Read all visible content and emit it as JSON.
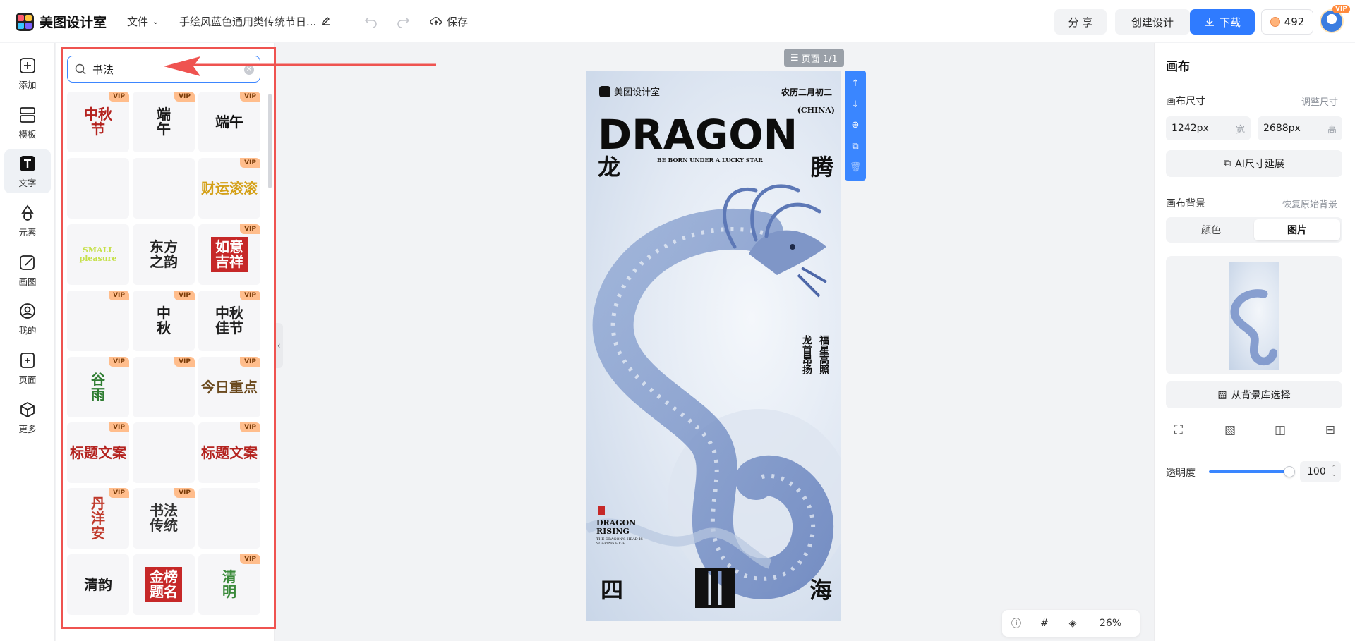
{
  "topbar": {
    "brand": "美图设计室",
    "file_menu": "文件",
    "doc_title": "手绘风蓝色通用类传统节日...",
    "save": "保存",
    "share": "分 享",
    "create": "创建设计",
    "download": "下载",
    "points": "492",
    "vip_badge": "VIP"
  },
  "rail": {
    "items": [
      {
        "label": "添加",
        "icon": "plus-square-icon"
      },
      {
        "label": "模板",
        "icon": "template-icon"
      },
      {
        "label": "文字",
        "icon": "text-icon"
      },
      {
        "label": "元素",
        "icon": "shapes-icon"
      },
      {
        "label": "画图",
        "icon": "draw-icon"
      },
      {
        "label": "我的",
        "icon": "user-icon"
      },
      {
        "label": "页面",
        "icon": "page-add-icon"
      },
      {
        "label": "更多",
        "icon": "box-icon"
      }
    ]
  },
  "panel": {
    "search_value": "书法",
    "vip": "VIP",
    "cells": [
      {
        "text": "中秋\n节",
        "color": "#b4231f",
        "vip": true
      },
      {
        "text": "端\n午",
        "color": "#1b1b1b",
        "vip": true
      },
      {
        "text": "端午",
        "color": "#111111",
        "vip": true
      },
      {
        "text": "",
        "color": "#555555",
        "vip": false
      },
      {
        "text": "",
        "color": "#c62828",
        "vip": false
      },
      {
        "text": "财运滚滚",
        "color": "#d4a017",
        "vip": true
      },
      {
        "text": "SMALL\npleasure",
        "color": "#c6e04a",
        "vip": false
      },
      {
        "text": "东方\n之韵",
        "color": "#222222",
        "vip": false
      },
      {
        "text": "如意\n吉祥",
        "color": "#ffffff",
        "vip": true
      },
      {
        "text": "",
        "color": "#f5e7b8",
        "vip": true
      },
      {
        "text": "中\n秋",
        "color": "#1a1a1a",
        "vip": true
      },
      {
        "text": "中秋\n佳节",
        "color": "#222222",
        "vip": true
      },
      {
        "text": "谷\n雨",
        "color": "#2f7d32",
        "vip": true
      },
      {
        "text": "",
        "color": "#e8c9a0",
        "vip": true
      },
      {
        "text": "今日重点",
        "color": "#6b4a1e",
        "vip": true
      },
      {
        "text": "标题文案",
        "color": "#b4231f",
        "vip": true
      },
      {
        "text": "",
        "color": "#f0f0f0",
        "vip": false
      },
      {
        "text": "标题文案",
        "color": "#b4231f",
        "vip": true
      },
      {
        "text": "丹\n洋\n安",
        "color": "#c0392b",
        "vip": true
      },
      {
        "text": "书法\n传统",
        "color": "#333333",
        "vip": true
      },
      {
        "text": "",
        "color": "#c62828",
        "vip": false
      },
      {
        "text": "清韵",
        "color": "#1a1a1a",
        "vip": false
      },
      {
        "text": "金榜\n题名",
        "color": "#ffffff",
        "vip": false
      },
      {
        "text": "清\n明",
        "color": "#3a8a3a",
        "vip": true
      }
    ]
  },
  "canvas": {
    "page_indicator": "页面 1/1",
    "poster": {
      "brand": "美图设计室",
      "lunar_date": "农历二月初二",
      "china": "(CHINA)",
      "headline": "DRAGON",
      "left_char": "龙",
      "right_char": "腾",
      "tagline": "BE BORN UNDER A LUCKY STAR",
      "vertical_1": "福星高照",
      "vertical_2": "龙首昂扬",
      "rising_1": "DRAGON",
      "rising_2": "RISING",
      "rising_sub_1": "THE DRAGON'S HEAD IS",
      "rising_sub_2": "SOARING HIGH",
      "bottom_left": "四",
      "bottom_right": "海"
    },
    "zoom": "26%"
  },
  "right": {
    "title": "画布",
    "size_label": "画布尺寸",
    "size_adjust": "调整尺寸",
    "width_value": "1242px",
    "width_unit": "宽",
    "height_value": "2688px",
    "height_unit": "高",
    "ai_extend": "AI尺寸延展",
    "bg_label": "画布背景",
    "bg_restore": "恢复原始背景",
    "tab_color": "颜色",
    "tab_image": "图片",
    "from_library": "从背景库选择",
    "opacity_label": "透明度",
    "opacity_value": "100"
  }
}
